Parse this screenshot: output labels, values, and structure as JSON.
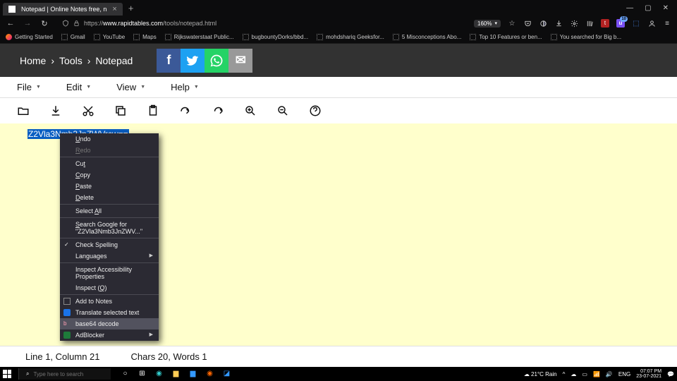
{
  "browser": {
    "tab_title": "Notepad | Online Notes free, n",
    "url_proto": "https://",
    "url_domain": "www.rapidtables.com",
    "url_path": "/tools/notepad.html",
    "zoom": "160%",
    "bookmarks": [
      "Getting Started",
      "Gmail",
      "YouTube",
      "Maps",
      "Rijkswaterstaat Public...",
      "bugbountyDorks/bbd...",
      "mohdshariq Geeksfor...",
      "5 Misconceptions Abo...",
      "Top 10 Features or ben...",
      "You searched for Big b..."
    ],
    "ublock_badge": "10"
  },
  "breadcrumb": {
    "home": "Home",
    "tools": "Tools",
    "page": "Notepad"
  },
  "menus": {
    "file": "File",
    "edit": "Edit",
    "view": "View",
    "help": "Help"
  },
  "editor": {
    "selected": "Z2Vla3Nmb3JnZWVrcw=="
  },
  "context": {
    "undo": "Undo",
    "redo": "Redo",
    "cut": "Cut",
    "copy": "Copy",
    "paste": "Paste",
    "delete": "Delete",
    "selectall": "Select All",
    "search": "Search Google for \"Z2Vla3Nmb3JnZWV...\"",
    "spell": "Check Spelling",
    "lang": "Languages",
    "access": "Inspect Accessibility Properties",
    "inspect": "Inspect (Q)",
    "addnotes": "Add to Notes",
    "translate": "Translate selected text",
    "b64": "base64 decode",
    "adb": "AdBlocker"
  },
  "status": {
    "pos": "Line 1, Column 21",
    "counts": "Chars 20, Words 1"
  },
  "taskbar": {
    "search_placeholder": "Type here to search",
    "weather": "21°C  Rain",
    "lang": "ENG",
    "time": "07:07 PM",
    "date": "23-07-2021"
  }
}
